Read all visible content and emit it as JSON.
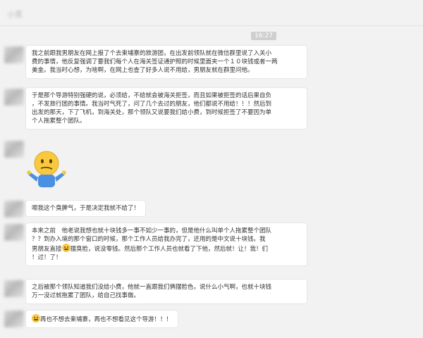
{
  "header": {
    "contact_name": "小蒸"
  },
  "timestamp": "16:27",
  "messages": [
    {
      "lines": [
        "我之前跟我男朋友在网上报了个去柬埔寨的旅游团，在出发前领队就在微信群里说了入关小",
        "费的事情，他反复强调了要我们每个人在海关签证通护照的时候里面夹一个１０块钱或者一两",
        "美金。我当时心想，为啥啊，在网上也查了好多人说不用给，男朋友就在群里问他。"
      ]
    },
    {
      "lines": [
        "于是那个导游特别强硬的说，必须给，不给就会被海关拒签，而且如果被拒签的话后果自负",
        "，不发旅行团的事情。我当时气死了，问了几个去过的朋友，他们都说不用给！！！然后到",
        "出发的那天，下了飞机，到海关处，那个领队又说要我们给小费，到时候拒签了不要因为单",
        "个人拖累整个团队。"
      ]
    },
    {
      "sticker": "thinking-face-sticker"
    },
    {
      "lines": [
        "嗯我这个臭脾气，于是决定我就不给了！"
      ]
    },
    {
      "lines": [
        "本来之前　他老说我想也就十块钱多一事不如少一事的，但是他什么叫单个人拖累整个团队",
        "？？到办入境的那个窗口的时候，那个工作人员给我办完了，还用的是中文说十块钱。我",
        {
          "before": "男朋友直接",
          "emoji": "grin-emoji",
          "after": "摆臭脸，说没零钱。然后那个工作人员也就看了下他，然后就！让！我！们"
        },
        "！过！了！"
      ]
    },
    {
      "lines": [
        "之后被那个领队知道我们没给小费，他就一直跟我们俩摆脸色，说什么小气啊，也就十块钱",
        "万一没过就拖累了团队，给自己找事做。"
      ]
    },
    {
      "lines": [
        {
          "before": "",
          "emoji": "grin-emoji",
          "after": "再也不想去柬埔寨，再也不想看见这个导游！！！"
        }
      ]
    }
  ]
}
